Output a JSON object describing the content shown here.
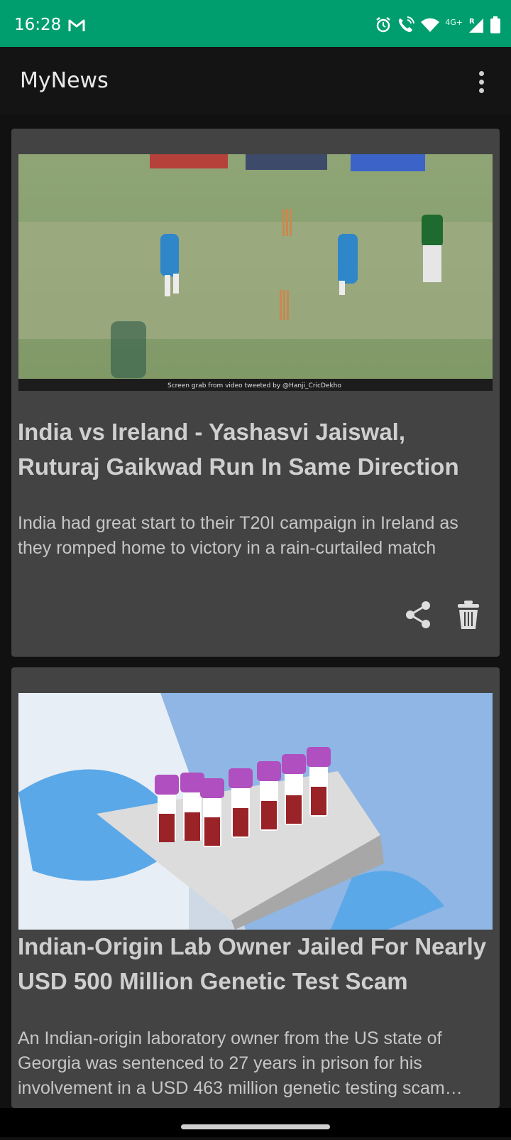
{
  "status": {
    "time": "16:28",
    "network": "4G+",
    "roaming": "R"
  },
  "app": {
    "title": "MyNews"
  },
  "articles": [
    {
      "title": "India vs Ireland - Yashasvi Jaiswal, Ruturaj Gaikwad Run In Same Direction",
      "summary": "India had great start to their T20I campaign in Ireland as they romped home to victory in a rain-curtailed match",
      "image_caption": "Screen grab from video tweeted by @Hanji_CricDekho"
    },
    {
      "title": "Indian-Origin Lab Owner Jailed For Nearly USD 500 Million Genetic Test Scam",
      "summary": "An Indian-origin laboratory owner from the US state of Georgia was sentenced to 27 years in prison for his involvement in a USD 463 million genetic testing scam scheme"
    }
  ],
  "colors": {
    "status_bar": "#009e6e",
    "card": "#434343",
    "background": "#111111"
  }
}
